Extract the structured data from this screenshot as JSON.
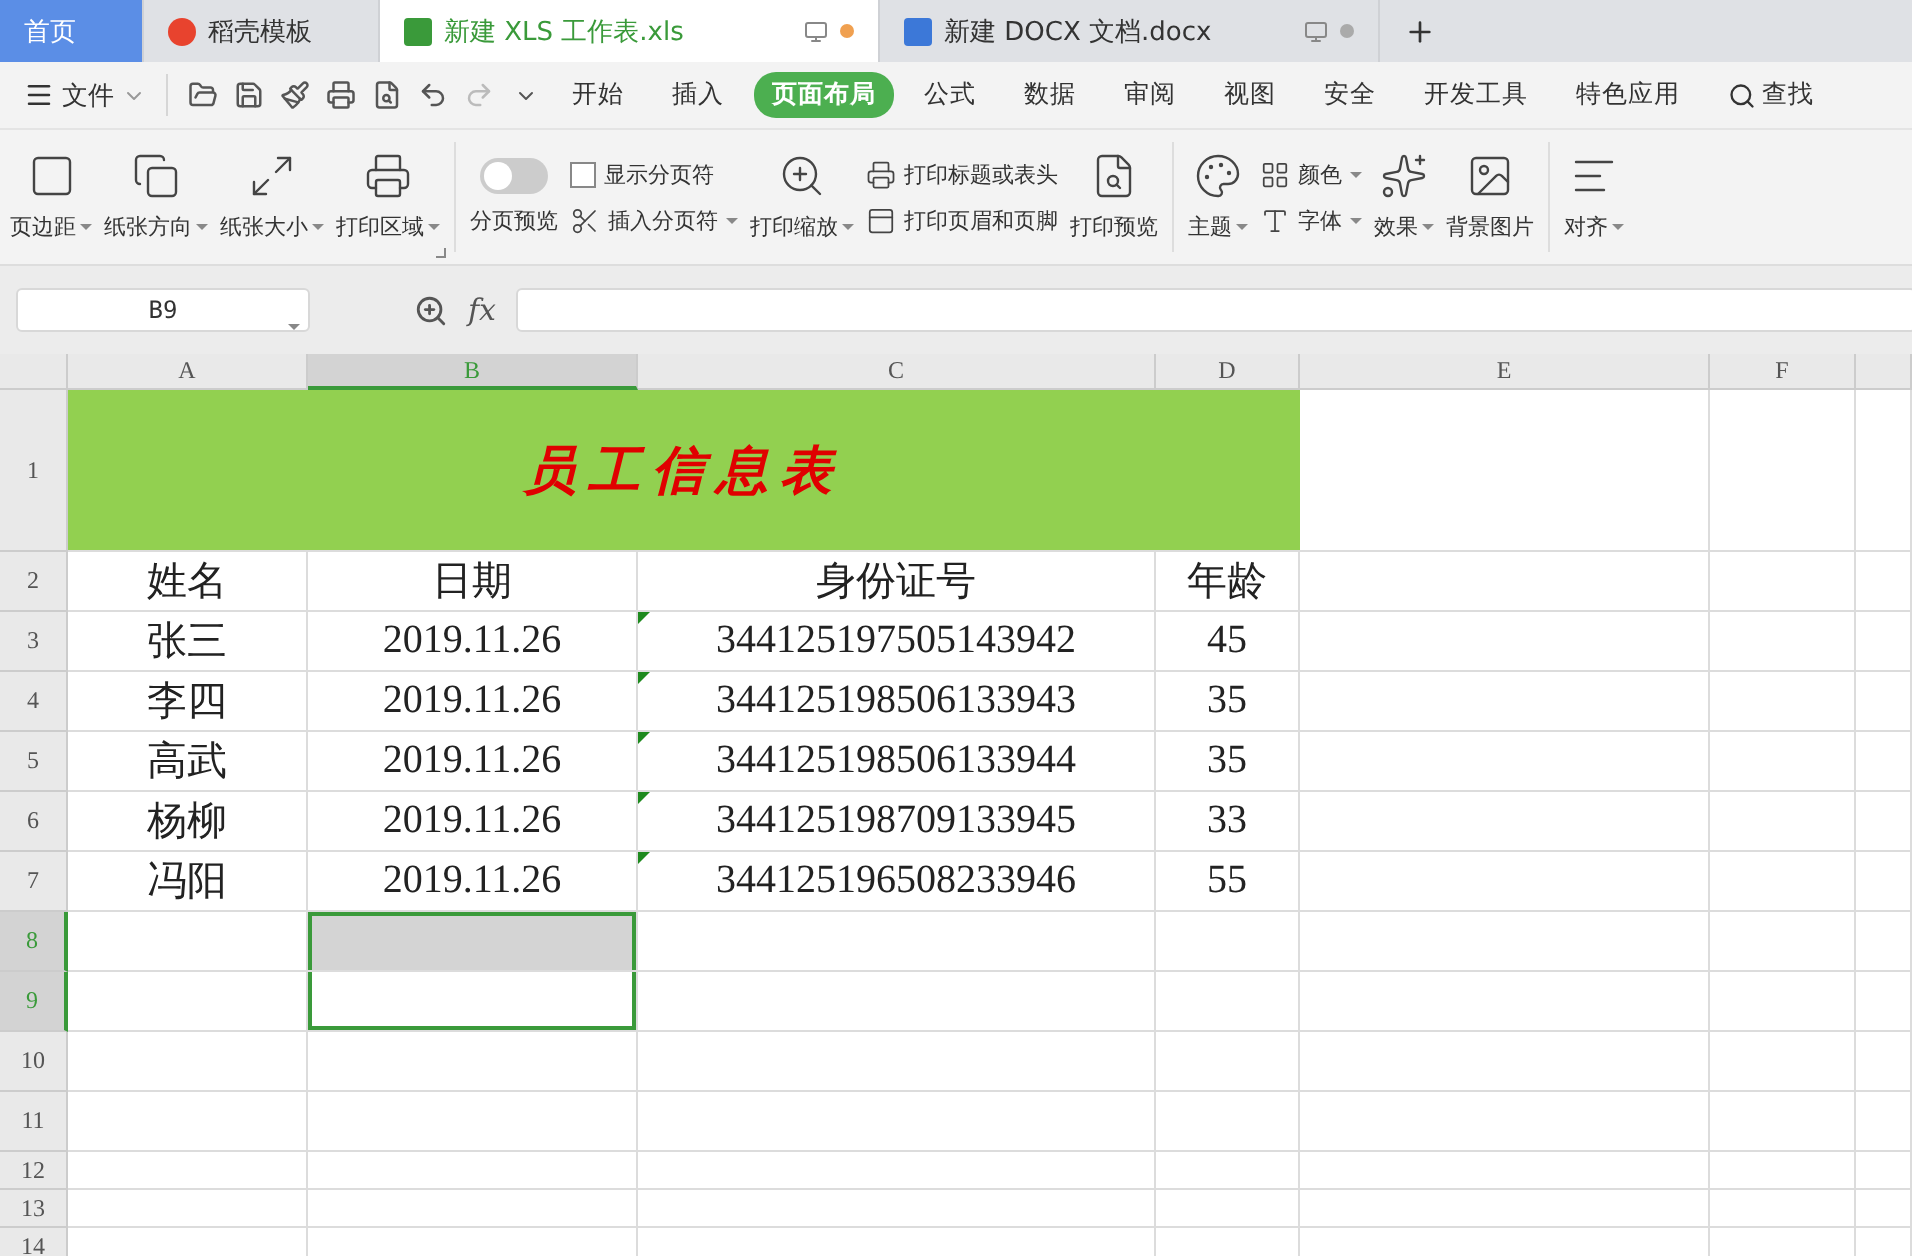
{
  "tabs": [
    {
      "kind": "home",
      "label": "首页",
      "selected": false
    },
    {
      "kind": "docer",
      "label": "稻壳模板",
      "selected": false
    },
    {
      "kind": "sheet",
      "label": "新建 XLS 工作表.xls",
      "selected": true,
      "modified": true
    },
    {
      "kind": "doc",
      "label": "新建 DOCX 文档.docx",
      "selected": false,
      "modified": false
    }
  ],
  "menu": {
    "file_label": "文件",
    "quick_actions": [
      {
        "disabled": false
      },
      {
        "disabled": false
      },
      {
        "disabled": false
      },
      {
        "disabled": false
      },
      {
        "disabled": false
      },
      {
        "disabled": false
      },
      {
        "disabled": true
      }
    ],
    "items": [
      {
        "label": "开始",
        "selected": false
      },
      {
        "label": "插入",
        "selected": false
      },
      {
        "label": "页面布局",
        "selected": true
      },
      {
        "label": "公式",
        "selected": false
      },
      {
        "label": "数据",
        "selected": false
      },
      {
        "label": "审阅",
        "selected": false
      },
      {
        "label": "视图",
        "selected": false
      },
      {
        "label": "安全",
        "selected": false
      },
      {
        "label": "开发工具",
        "selected": false
      },
      {
        "label": "特色应用",
        "selected": false
      }
    ],
    "search_label": "查找"
  },
  "ribbon": [
    {
      "kind": "large",
      "label": "页边距",
      "dropdown": true
    },
    {
      "kind": "large",
      "label": "纸张方向",
      "dropdown": true
    },
    {
      "kind": "large",
      "label": "纸张大小",
      "dropdown": true
    },
    {
      "kind": "large",
      "label": "打印区域",
      "dropdown": true,
      "launcher": true
    },
    {
      "kind": "separator"
    },
    {
      "kind": "toggle",
      "label": "分页预览",
      "on": false
    },
    {
      "kind": "stack",
      "items": [
        {
          "kind": "checkbox",
          "label": "显示分页符",
          "checked": false
        },
        {
          "kind": "small",
          "label": "插入分页符",
          "dropdown": true
        }
      ]
    },
    {
      "kind": "large",
      "label": "打印缩放",
      "dropdown": true
    },
    {
      "kind": "stack",
      "items": [
        {
          "kind": "small",
          "label": "打印标题或表头",
          "dropdown": false
        },
        {
          "kind": "small",
          "label": "打印页眉和页脚",
          "dropdown": false
        }
      ]
    },
    {
      "kind": "large",
      "label": "打印预览",
      "dropdown": false
    },
    {
      "kind": "separator"
    },
    {
      "kind": "large",
      "label": "主题",
      "dropdown": true
    },
    {
      "kind": "stack",
      "items": [
        {
          "kind": "small",
          "label": "颜色",
          "dropdown": true
        },
        {
          "kind": "small",
          "label": "字体",
          "dropdown": true
        }
      ]
    },
    {
      "kind": "large",
      "label": "效果",
      "dropdown": true
    },
    {
      "kind": "large",
      "label": "背景图片",
      "dropdown": false
    },
    {
      "kind": "separator"
    },
    {
      "kind": "large",
      "label": "对齐",
      "dropdown": true
    }
  ],
  "formula_bar": {
    "name_box": "B9",
    "fx_label": "fx"
  },
  "sheet": {
    "columns": [
      {
        "label": "A",
        "selected": false
      },
      {
        "label": "B",
        "selected": true
      },
      {
        "label": "C",
        "selected": false
      },
      {
        "label": "D",
        "selected": false
      },
      {
        "label": "E",
        "selected": false
      },
      {
        "label": "F",
        "selected": false
      }
    ],
    "rows": [
      {
        "header": "1",
        "selected": false,
        "kind": "title",
        "title": "员工信息表"
      },
      {
        "header": "2",
        "selected": false,
        "kind": "data",
        "cells": [
          {
            "text": "姓名",
            "warning": false
          },
          {
            "text": "日期",
            "warning": false
          },
          {
            "text": "身份证号",
            "warning": false
          },
          {
            "text": "年龄",
            "warning": false
          }
        ]
      },
      {
        "header": "3",
        "selected": false,
        "kind": "data",
        "cells": [
          {
            "text": "张三",
            "warning": false
          },
          {
            "text": "2019.11.26",
            "warning": false
          },
          {
            "text": "344125197505143942",
            "warning": true
          },
          {
            "text": "45",
            "warning": false
          }
        ]
      },
      {
        "header": "4",
        "selected": false,
        "kind": "data",
        "cells": [
          {
            "text": "李四",
            "warning": false
          },
          {
            "text": "2019.11.26",
            "warning": false
          },
          {
            "text": "344125198506133943",
            "warning": true
          },
          {
            "text": "35",
            "warning": false
          }
        ]
      },
      {
        "header": "5",
        "selected": false,
        "kind": "data",
        "cells": [
          {
            "text": "高武",
            "warning": false
          },
          {
            "text": "2019.11.26",
            "warning": false
          },
          {
            "text": "344125198506133944",
            "warning": true
          },
          {
            "text": "35",
            "warning": false
          }
        ]
      },
      {
        "header": "6",
        "selected": false,
        "kind": "data",
        "cells": [
          {
            "text": "杨柳",
            "warning": false
          },
          {
            "text": "2019.11.26",
            "warning": false
          },
          {
            "text": "344125198709133945",
            "warning": true
          },
          {
            "text": "33",
            "warning": false
          }
        ]
      },
      {
        "header": "7",
        "selected": false,
        "kind": "data",
        "cells": [
          {
            "text": "冯阳",
            "warning": false
          },
          {
            "text": "2019.11.26",
            "warning": false
          },
          {
            "text": "344125196508233946",
            "warning": true
          },
          {
            "text": "55",
            "warning": false
          }
        ]
      },
      {
        "header": "8",
        "selected": true,
        "active": false,
        "kind": "data",
        "cells": []
      },
      {
        "header": "9",
        "selected": true,
        "active": true,
        "kind": "data",
        "cells": []
      },
      {
        "header": "10",
        "selected": false,
        "kind": "data",
        "cells": []
      },
      {
        "header": "11",
        "selected": false,
        "kind": "data",
        "cells": []
      },
      {
        "header": "12",
        "selected": false,
        "kind": "data",
        "cells": []
      },
      {
        "header": "13",
        "selected": false,
        "kind": "data",
        "cells": []
      },
      {
        "header": "14",
        "selected": false,
        "kind": "data",
        "cells": []
      }
    ]
  }
}
